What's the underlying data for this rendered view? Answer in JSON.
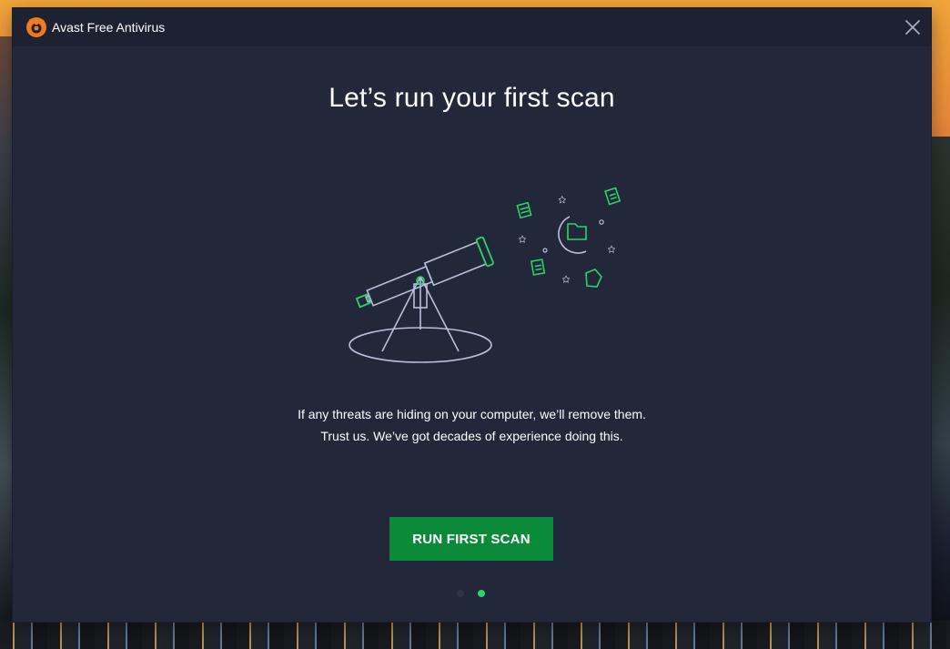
{
  "window": {
    "title": "Avast Free Antivirus",
    "logo_icon": "avast-logo-icon",
    "close_icon": "close-icon"
  },
  "main": {
    "headline": "Let’s run your first scan",
    "description_line1": "If any threats are hiding on your computer, we’ll remove them.",
    "description_line2": "Trust us. We’ve got decades of experience doing this.",
    "cta_label": "RUN FIRST SCAN",
    "illustration": "telescope-night-sky-illustration"
  },
  "pager": {
    "total_pages": 2,
    "current_page": 2
  },
  "colors": {
    "window_bg": "#222739",
    "titlebar_bg": "#1d2233",
    "accent_green": "#0b8a3a",
    "dot_active": "#2bd46b",
    "logo_orange": "#f07a1e"
  }
}
